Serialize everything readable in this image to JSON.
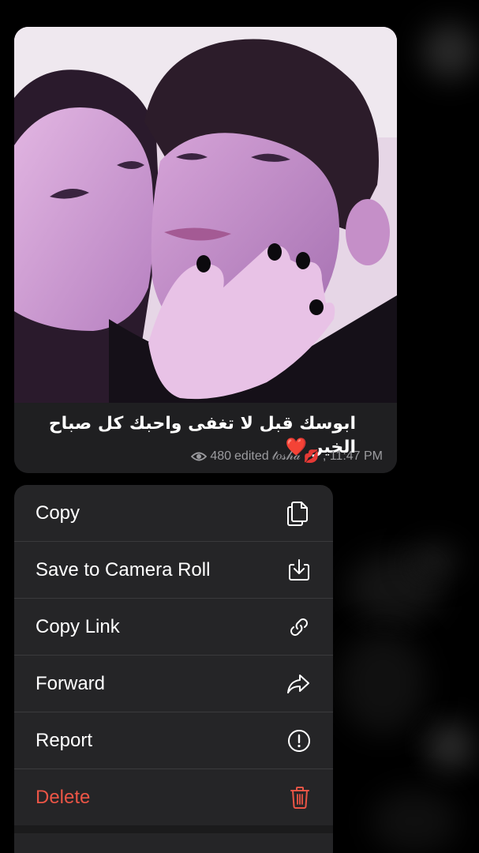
{
  "message": {
    "caption": "ابوسك قبل لا تغفى واحبك كل صباح الخير",
    "caption_emoji": "❤️",
    "views": "480",
    "status": "edited",
    "author": "𝓉𝑜𝓈𝒽𝒶",
    "author_emoji": "💋",
    "time": ", 11:47 PM"
  },
  "menu": {
    "items": [
      {
        "label": "Copy",
        "icon": "copy-icon"
      },
      {
        "label": "Save to Camera Roll",
        "icon": "save-to-camera-roll-icon"
      },
      {
        "label": "Copy Link",
        "icon": "link-icon"
      },
      {
        "label": "Forward",
        "icon": "forward-arrow-icon"
      },
      {
        "label": "Report",
        "icon": "exclamation-circle-icon"
      },
      {
        "label": "Delete",
        "icon": "trash-icon"
      }
    ],
    "danger_color": "#eb5546"
  }
}
